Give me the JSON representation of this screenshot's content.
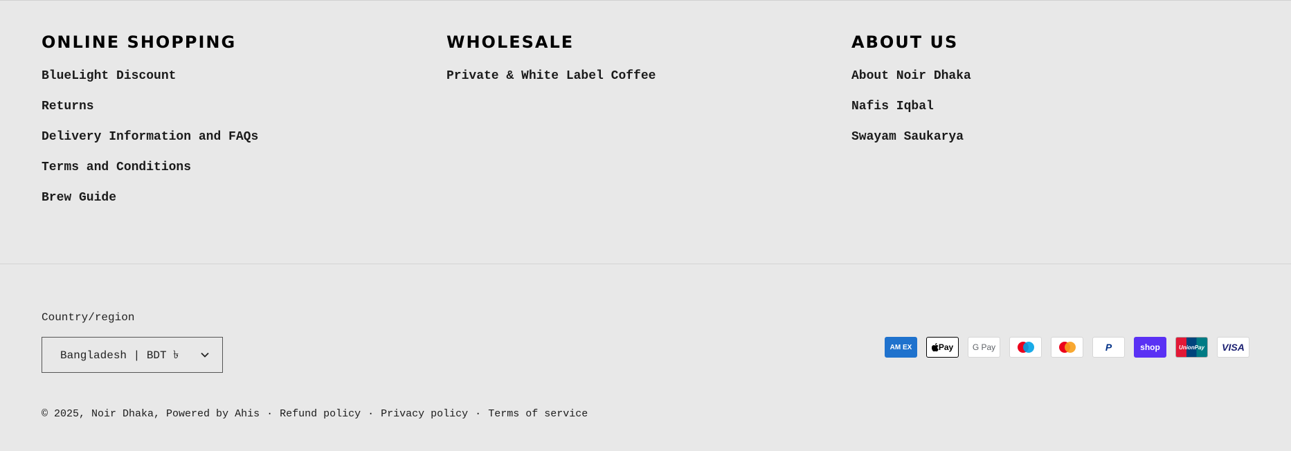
{
  "columns": [
    {
      "heading": "ONLINE SHOPPING",
      "links": [
        "BlueLight Discount",
        "Returns",
        "Delivery Information and FAQs",
        "Terms and Conditions",
        "Brew Guide"
      ]
    },
    {
      "heading": "WHOLESALE",
      "links": [
        "Private & White Label Coffee"
      ]
    },
    {
      "heading": "ABOUT US",
      "links": [
        "About Noir Dhaka",
        "Nafis Iqbal",
        "Swayam Saukarya"
      ]
    }
  ],
  "country": {
    "label": "Country/region",
    "selected": "Bangladesh | BDT ৳"
  },
  "payments": {
    "amex": "AM EX",
    "applepay": "Pay",
    "gpay": "G Pay",
    "paypal": "P",
    "shopify": "shop",
    "unionpay_1": "Union",
    "unionpay_2": "Pay",
    "visa": "VISA",
    "colors": {
      "amex": "#1f72cd",
      "shopify": "#5a31f4",
      "maestro_red": "#eb001b",
      "maestro_blue": "#00a2e5",
      "mastercard_red": "#eb001b",
      "mastercard_yellow": "#f79e1b",
      "visa": "#1a1f71"
    }
  },
  "footer": {
    "copyright": "© 2025,",
    "store": "Noir Dhaka",
    "powered": ", Powered by Ahis",
    "sep": "·",
    "refund": "Refund policy",
    "privacy": "Privacy policy",
    "terms": "Terms of service"
  },
  "theme": {
    "background": "#e8e8e8",
    "text": "#1a1a1a"
  }
}
